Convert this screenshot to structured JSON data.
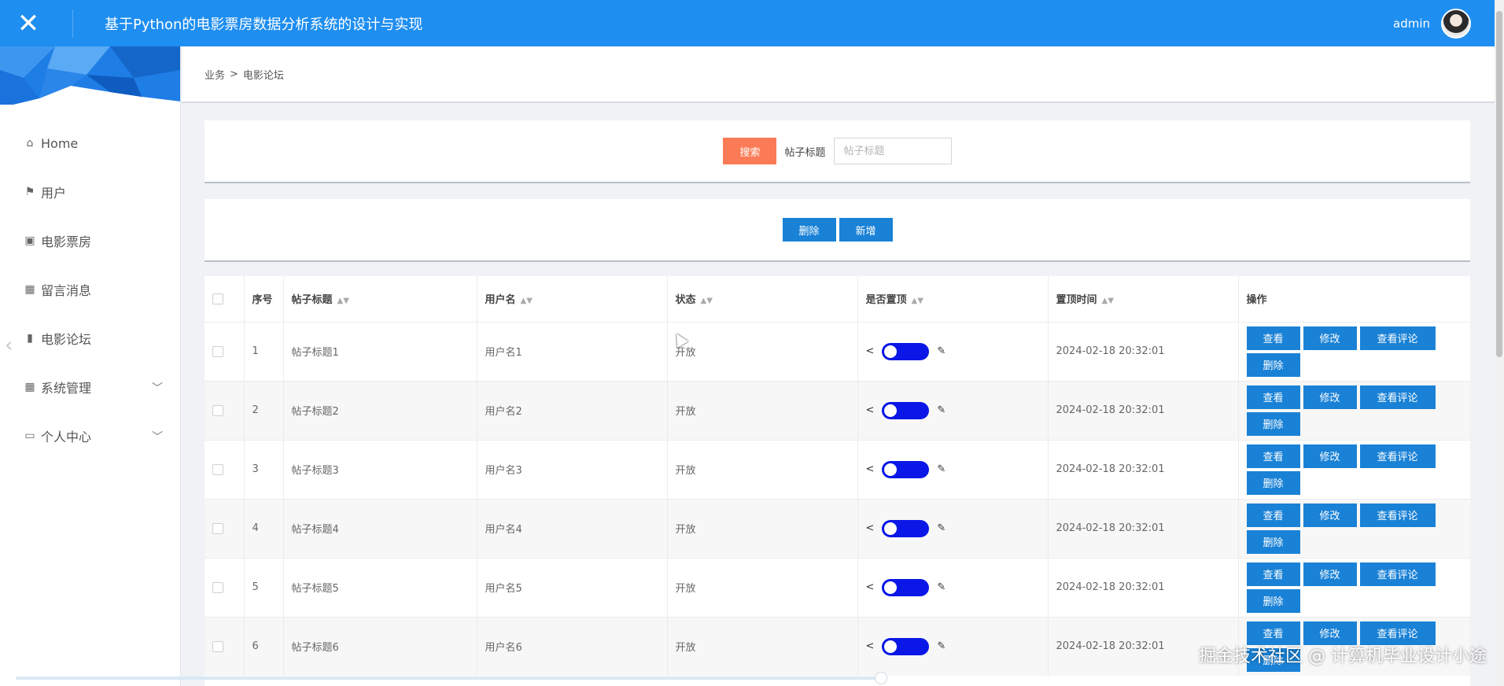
{
  "header": {
    "close_icon": "close-icon",
    "title": "基于Python的电影票房数据分析系统的设计与实现",
    "username": "admin"
  },
  "sidebar": {
    "items": [
      {
        "label": "Home",
        "icon": "home-icon"
      },
      {
        "label": "用户",
        "icon": "flag-icon"
      },
      {
        "label": "电影票房",
        "icon": "chart-box-icon"
      },
      {
        "label": "留言消息",
        "icon": "grid-icon"
      },
      {
        "label": "电影论坛",
        "icon": "bar-chart-icon"
      },
      {
        "label": "系统管理",
        "icon": "grid-icon",
        "expandable": true
      },
      {
        "label": "个人中心",
        "icon": "card-icon",
        "expandable": true
      }
    ]
  },
  "breadcrumb": {
    "parent": "业务",
    "separator": ">",
    "current": "电影论坛"
  },
  "search": {
    "button": "搜索",
    "label": "帖子标题",
    "placeholder": "帖子标题",
    "value": ""
  },
  "actions": {
    "delete": "删除",
    "add": "新增"
  },
  "table": {
    "columns": {
      "index": "序号",
      "title": "帖子标题",
      "user": "用户名",
      "status": "状态",
      "pinned": "是否置顶",
      "pin_time": "置顶时间",
      "ops": "操作"
    },
    "op_labels": {
      "view": "查看",
      "edit": "修改",
      "comments": "查看评论",
      "delete": "删除"
    },
    "rows": [
      {
        "index": "1",
        "title": "帖子标题1",
        "user": "用户名1",
        "status": "开放",
        "pin_time": "2024-02-18 20:32:01"
      },
      {
        "index": "2",
        "title": "帖子标题2",
        "user": "用户名2",
        "status": "开放",
        "pin_time": "2024-02-18 20:32:01"
      },
      {
        "index": "3",
        "title": "帖子标题3",
        "user": "用户名3",
        "status": "开放",
        "pin_time": "2024-02-18 20:32:01"
      },
      {
        "index": "4",
        "title": "帖子标题4",
        "user": "用户名4",
        "status": "开放",
        "pin_time": "2024-02-18 20:32:01"
      },
      {
        "index": "5",
        "title": "帖子标题5",
        "user": "用户名5",
        "status": "开放",
        "pin_time": "2024-02-18 20:32:01"
      },
      {
        "index": "6",
        "title": "帖子标题6",
        "user": "用户名6",
        "status": "开放",
        "pin_time": "2024-02-18 20:32:01"
      }
    ]
  },
  "watermark": "掘金技术社区 @ 计算机毕业设计小途",
  "colors": {
    "header": "#1e8ef0",
    "search_button": "#fa7b56",
    "action_button": "#1a82d6",
    "toggle": "#0a17e6"
  }
}
